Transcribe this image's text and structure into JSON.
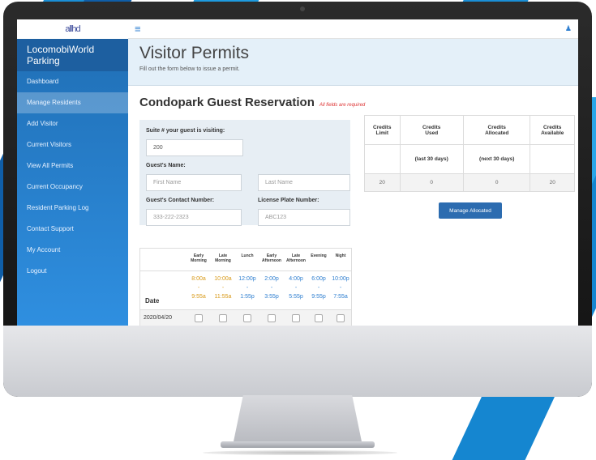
{
  "window": {
    "logo_text": "allhd",
    "brand": "LocomobiWorld Parking"
  },
  "sidebar": {
    "items": [
      {
        "label": "Dashboard"
      },
      {
        "label": "Manage Residents"
      },
      {
        "label": "Add Visitor"
      },
      {
        "label": "Current Visitors"
      },
      {
        "label": "View All Permits"
      },
      {
        "label": "Current Occupancy"
      },
      {
        "label": "Resident Parking Log"
      },
      {
        "label": "Contact Support"
      },
      {
        "label": "My Account"
      },
      {
        "label": "Logout"
      }
    ],
    "active_index": 1
  },
  "topbar": {
    "menu_glyph": "≡",
    "user_glyph": "♟"
  },
  "header": {
    "title": "Visitor Permits",
    "subtitle": "Fill out the form below to issue a permit."
  },
  "reservation": {
    "title": "Condopark Guest Reservation",
    "required_note": "All fields are required"
  },
  "form": {
    "suite_label": "Suite # your guest is visiting:",
    "suite_value": "200",
    "guest_name_label": "Guest's Name:",
    "first_name_placeholder": "First Name",
    "last_name_placeholder": "Last Name",
    "contact_label": "Guest's Contact Number:",
    "contact_placeholder": "333-222-2323",
    "plate_label": "License Plate Number:",
    "plate_placeholder": "ABC123"
  },
  "schedule": {
    "periods": [
      {
        "line1": "Early",
        "line2": "Morning",
        "start": "8:00a",
        "end": "9:55a",
        "color": "orange"
      },
      {
        "line1": "Late",
        "line2": "Morning",
        "start": "10:00a",
        "end": "11:55a",
        "color": "orange"
      },
      {
        "line1": "",
        "line2": "Lunch",
        "start": "12:00p",
        "end": "1:55p",
        "color": "blue"
      },
      {
        "line1": "Early",
        "line2": "Afternoon",
        "start": "2:00p",
        "end": "3:55p",
        "color": "blue"
      },
      {
        "line1": "Late",
        "line2": "Afternoon",
        "start": "4:00p",
        "end": "5:55p",
        "color": "blue"
      },
      {
        "line1": "",
        "line2": "Evening",
        "start": "6:00p",
        "end": "9:55p",
        "color": "blue"
      },
      {
        "line1": "",
        "line2": "Night",
        "start": "10:00p",
        "end": "7:55a",
        "color": "blue"
      }
    ],
    "dash": "-",
    "date_label": "Date",
    "rows": [
      {
        "date": "2020/04/20"
      }
    ]
  },
  "credits": {
    "headers": [
      {
        "line1": "Credits",
        "line2": "Limit"
      },
      {
        "line1": "Credits",
        "line2": "Used"
      },
      {
        "line1": "Credits",
        "line2": "Allocated"
      },
      {
        "line1": "Credits",
        "line2": "Available"
      }
    ],
    "subheaders": [
      "",
      "(last 30 days)",
      "(next 30 days)",
      ""
    ],
    "values": [
      "20",
      "0",
      "0",
      "20"
    ],
    "button_label": "Manage Allocated"
  }
}
